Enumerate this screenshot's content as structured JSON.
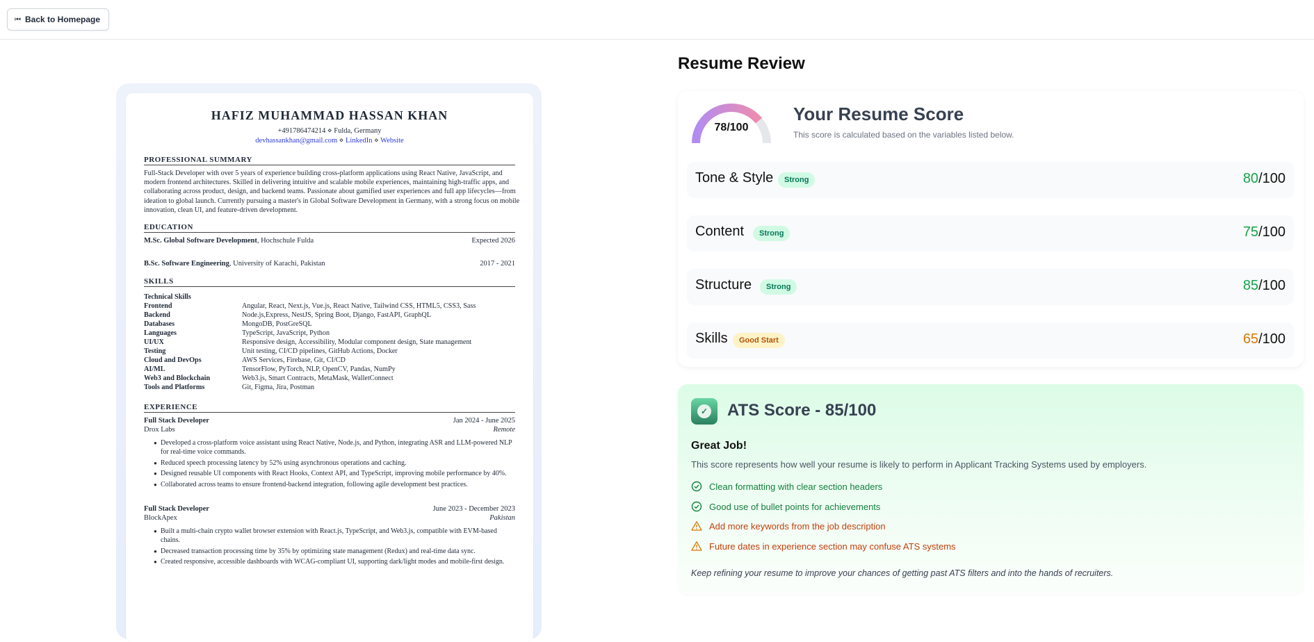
{
  "topbar": {
    "back_label": "Back to Homepage"
  },
  "resume": {
    "name": "HAFIZ MUHAMMAD HASSAN KHAN",
    "contact": "+491786474214 ⋄ Fulda, Germany",
    "email": "devhassankhan@gmail.com",
    "link_sep": "⋄",
    "linkedin": "LinkedIn",
    "website": "Website",
    "summary_heading": "PROFESSIONAL SUMMARY",
    "summary": "Full-Stack Developer with over 5 years of experience building cross-platform applications using React Native, JavaScript, and modern frontend architectures. Skilled in delivering intuitive and scalable mobile experiences, maintaining high-traffic apps, and collaborating across product, design, and backend teams. Passionate about gamified user experiences and full app lifecycles—from ideation to global launch. Currently pursuing a master's in Global Software Development in Germany, with a strong focus on mobile innovation, clean UI, and feature-driven development.",
    "education_heading": "EDUCATION",
    "education": [
      {
        "degree": "M.Sc. Global Software Development",
        "school": ", Hochschule Fulda",
        "date": "Expected 2026"
      },
      {
        "degree": "B.Sc. Software Engineering",
        "school": ", University of Karachi, Pakistan",
        "date": "2017 - 2021"
      }
    ],
    "skills_heading": "SKILLS",
    "skills_subheading": "Technical Skills",
    "skills": [
      {
        "cat": "Frontend",
        "val": "Angular, React, Next.js, Vue.js, React Native, Tailwind CSS, HTML5, CSS3, Sass"
      },
      {
        "cat": "Backend",
        "val": "Node.js,Express, NestJS, Spring Boot, Django, FastAPI, GraphQL"
      },
      {
        "cat": "Databases",
        "val": "MongoDB, PostGreSQL"
      },
      {
        "cat": "Languages",
        "val": "TypeScript, JavaScript, Python"
      },
      {
        "cat": "UI/UX",
        "val": "Responsive design, Accessibility, Modular component design, State management"
      },
      {
        "cat": "Testing",
        "val": "Unit testing, CI/CD pipelines, GitHub Actions, Docker"
      },
      {
        "cat": "Cloud and DevOps",
        "val": "AWS Services, Firebase, Git, CI/CD"
      },
      {
        "cat": "AI/ML",
        "val": "TensorFlow, PyTorch, NLP, OpenCV, Pandas, NumPy"
      },
      {
        "cat": "Web3 and Blockchain",
        "val": "Web3.js, Smart Contracts, MetaMask, WalletConnect"
      },
      {
        "cat": "Tools and Platforms",
        "val": "Git, Figma, Jira, Postman"
      }
    ],
    "experience_heading": "EXPERIENCE",
    "jobs": [
      {
        "title": "Full Stack Developer",
        "date": "Jan 2024 - June 2025",
        "company": "Drox Labs",
        "location": "Remote",
        "bullets": [
          "Developed a cross-platform voice assistant using React Native, Node.js, and Python, integrating ASR and LLM-powered NLP for real-time voice commands.",
          "Reduced speech processing latency by 52% using asynchronous operations and caching.",
          "Designed reusable UI components with React Hooks, Context API, and TypeScript, improving mobile performance by 40%.",
          "Collaborated across teams to ensure frontend-backend integration, following agile development best practices."
        ]
      },
      {
        "title": "Full Stack Developer",
        "date": "June 2023 - December 2023",
        "company": "BlockApex",
        "location": "Pakistan",
        "bullets": [
          "Built a multi-chain crypto wallet browser extension with React.js, TypeScript, and Web3.js, compatible with EVM-based chains.",
          "Decreased transaction processing time by 35% by optimizing state management (Redux) and real-time data sync.",
          "Created responsive, accessible dashboards with WCAG-compliant UI, supporting dark/light modes and mobile-first design."
        ]
      }
    ]
  },
  "review": {
    "title": "Resume Review",
    "score_value": 78,
    "score_max": 100,
    "score_label": "78/100",
    "score_title": "Your Resume Score",
    "score_desc": "This score is calculated based on the variables listed below.",
    "gauge_colors": [
      "#b28cf0",
      "#f58ca6",
      "#e5e7eb"
    ],
    "categories": [
      {
        "name": "Tone & Style",
        "badge": "Strong",
        "badge_type": "strong",
        "score": "80",
        "max": "/100",
        "tone": "green"
      },
      {
        "name": "Content",
        "badge": "Strong",
        "badge_type": "strong",
        "score": "75",
        "max": "/100",
        "tone": "green"
      },
      {
        "name": "Structure",
        "badge": "Strong",
        "badge_type": "strong",
        "score": "85",
        "max": "/100",
        "tone": "green"
      },
      {
        "name": "Skills",
        "badge": "Good Start",
        "badge_type": "good",
        "score": "65",
        "max": "/100",
        "tone": "amber"
      }
    ]
  },
  "ats": {
    "title": "ATS Score - 85/100",
    "subtitle": "Great Job!",
    "desc": "This score represents how well your resume is likely to perform in Applicant Tracking Systems used by employers.",
    "items": [
      {
        "type": "ok",
        "text": "Clean formatting with clear section headers"
      },
      {
        "type": "ok",
        "text": "Good use of bullet points for achievements"
      },
      {
        "type": "warn",
        "text": "Add more keywords from the job description"
      },
      {
        "type": "warn",
        "text": "Future dates in experience section may confuse ATS systems"
      }
    ],
    "footer": "Keep refining your resume to improve your chances of getting past ATS filters and into the hands of recruiters."
  }
}
